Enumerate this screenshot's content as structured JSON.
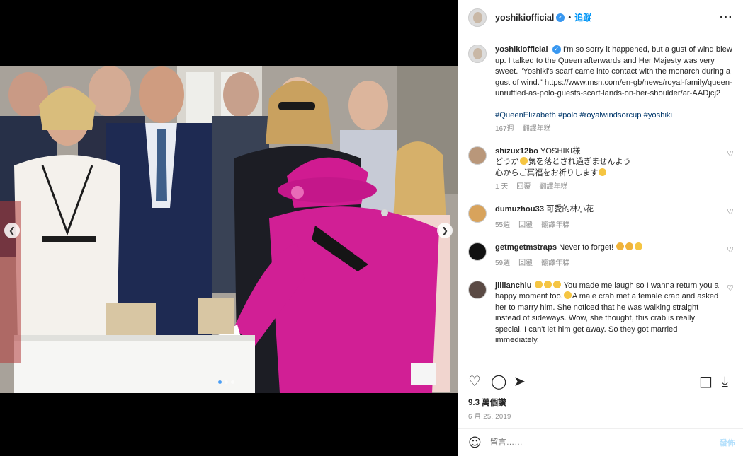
{
  "post": {
    "username": "yoshikiofficial",
    "verified_icon": "verified-badge-icon",
    "separator": "•",
    "follow_label": "追蹤",
    "more_icon": "more-options-icon"
  },
  "caption": {
    "username": "yoshikiofficial",
    "text": "I'm so sorry it happened, but a gust of wind blew up. I talked to the Queen afterwards and Her Majesty was very sweet. \"Yoshiki's scarf came into contact with the monarch during a gust of wind.\" https://www.msn.com/en-gb/news/royal-family/queen-unruffled-as-polo-guests-scarf-lands-on-her-shoulder/ar-AADjcj2",
    "hashtags": "#QueenElizabeth #polo #royalwindsorcup #yoshiki",
    "time": "167週",
    "translate": "翻譯年糕"
  },
  "comments": [
    {
      "username": "shizux12bo",
      "line1": "YOSHIKI様",
      "line2a": "どうか",
      "line2b": "気を落とされ過ぎませんよう",
      "line3": "心からご冥福をお祈りします",
      "time": "1 天",
      "reply": "回覆",
      "translate": "翻譯年糕"
    },
    {
      "username": "dumuzhou33",
      "text": "可愛的林小花",
      "time": "55週",
      "reply": "回覆",
      "translate": "翻譯年糕"
    },
    {
      "username": "getmgetmstraps",
      "text": "Never to forget!",
      "time": "59週",
      "reply": "回覆",
      "translate": "翻譯年糕"
    },
    {
      "username": "jillianchiu",
      "text_a": "You made me laugh so I wanna return you a happy moment too.",
      "text_b": "A male crab met a female crab and asked her to marry him. She noticed that he was walking straight instead of sideways. Wow, she thought, this crab is really special. I can't let him get away. So they got married immediately."
    }
  ],
  "actions": {
    "like_icon": "heart-icon",
    "comment_icon": "comment-icon",
    "share_icon": "share-icon",
    "save_icon": "bookmark-icon",
    "download_icon": "download-icon"
  },
  "stats": {
    "views": "9.3 萬個讚",
    "date": "6 月 25, 2019"
  },
  "composer": {
    "placeholder": "留言……",
    "post_label": "發佈",
    "emoji_icon": "emoji-icon"
  },
  "media": {
    "prev_icon": "chevron-left-icon",
    "next_icon": "chevron-right-icon",
    "slide_count": 3,
    "active_slide": 1
  }
}
